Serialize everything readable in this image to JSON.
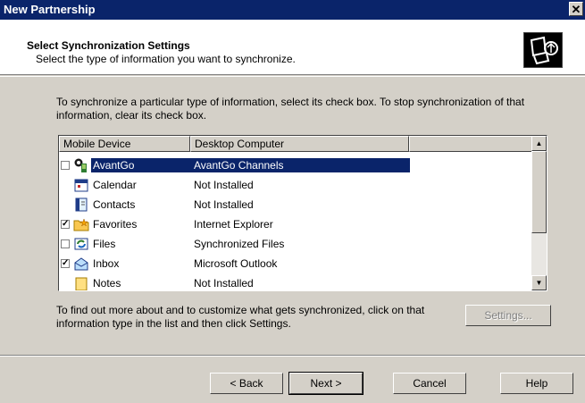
{
  "window": {
    "title": "New Partnership"
  },
  "header": {
    "title": "Select Synchronization Settings",
    "subtitle": "Select the type of information you want to synchronize."
  },
  "intro": "To synchronize a particular type of information, select its check box. To stop synchronization of that information, clear its check box.",
  "list": {
    "columns": [
      "Mobile Device",
      "Desktop Computer"
    ],
    "rows": [
      {
        "name": "AvantGo",
        "value": "AvantGo Channels",
        "checked": false,
        "selected": true,
        "has_checkbox": true,
        "icon": "avantgo-icon"
      },
      {
        "name": "Calendar",
        "value": "Not Installed",
        "checked": false,
        "selected": false,
        "has_checkbox": false,
        "icon": "calendar-icon"
      },
      {
        "name": "Contacts",
        "value": "Not Installed",
        "checked": false,
        "selected": false,
        "has_checkbox": false,
        "icon": "contacts-icon"
      },
      {
        "name": "Favorites",
        "value": "Internet Explorer",
        "checked": true,
        "selected": false,
        "has_checkbox": true,
        "icon": "favorites-folder-icon"
      },
      {
        "name": "Files",
        "value": "Synchronized Files",
        "checked": false,
        "selected": false,
        "has_checkbox": true,
        "icon": "files-sync-icon"
      },
      {
        "name": "Inbox",
        "value": "Microsoft Outlook",
        "checked": true,
        "selected": false,
        "has_checkbox": true,
        "icon": "inbox-icon"
      },
      {
        "name": "Notes",
        "value": "Not Installed",
        "checked": false,
        "selected": false,
        "has_checkbox": false,
        "icon": "notes-icon"
      }
    ]
  },
  "info": "To find out more about and to customize what gets synchronized, click on that information type in the list and then click Settings.",
  "buttons": {
    "settings": "Settings...",
    "back": "< Back",
    "next": "Next >",
    "cancel": "Cancel",
    "help": "Help"
  },
  "colors": {
    "titlebar": "#0a246a",
    "dialog": "#d4d0c8",
    "selection": "#0a246a"
  }
}
